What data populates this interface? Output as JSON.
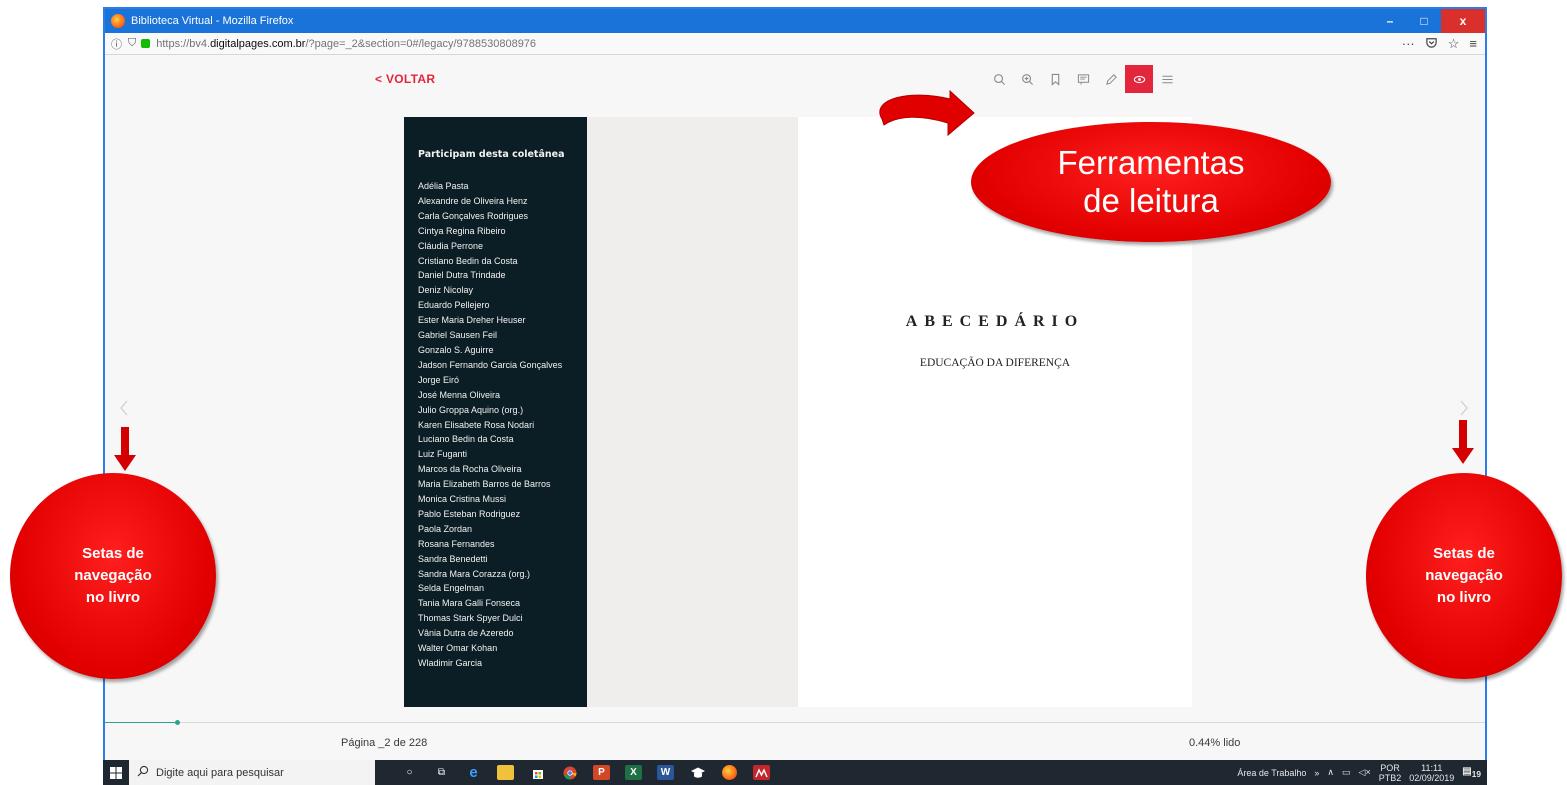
{
  "browser": {
    "window_title": "Biblioteca Virtual - Mozilla Firefox",
    "url_prefix": "https://bv4.",
    "url_domain": "digitalpages.com.br",
    "url_path": "/?page=_2&section=0#/legacy/9788530808976",
    "controls": {
      "minimize": "–",
      "maximize": "□",
      "close": "x"
    }
  },
  "reader": {
    "back_label": "< VOLTAR",
    "tools": [
      {
        "icon": "search-icon"
      },
      {
        "icon": "zoom-in-icon"
      },
      {
        "icon": "bookmark-icon"
      },
      {
        "icon": "notes-icon"
      },
      {
        "icon": "pencil-icon"
      },
      {
        "icon": "eye-icon",
        "active": true
      },
      {
        "icon": "menu-icon"
      }
    ],
    "accent_color": "#e3263b",
    "page_info": "Página _2 de 228",
    "progress_label": "0.44% lido",
    "progress_fraction": 0.0044
  },
  "book": {
    "left_heading": "Participam desta coletânea",
    "contributors": [
      "Adélia Pasta",
      "Alexandre de Oliveira Henz",
      "Carla Gonçalves Rodrigues",
      "Cintya Regina Ribeiro",
      "Cláudia Perrone",
      "Cristiano Bedin da Costa",
      "Daniel Dutra Trindade",
      "Deniz Nicolay",
      "Eduardo Pellejero",
      "Ester Maria Dreher Heuser",
      "Gabriel Sausen Feil",
      "Gonzalo S. Aguirre",
      "Jadson Fernando Garcia Gonçalves",
      "Jorge Eiró",
      "José Menna Oliveira",
      "Julio Groppa Aquino (org.)",
      "Karen Elisabete Rosa Nodari",
      "Luciano Bedin da Costa",
      "Luiz Fuganti",
      "Marcos da Rocha Oliveira",
      "Maria Elizabeth Barros de Barros",
      "Monica Cristina Mussi",
      "Pablo Esteban Rodriguez",
      "Paola Zordan",
      "Rosana Fernandes",
      "Sandra Benedetti",
      "Sandra Mara Corazza (org.)",
      "Selda Engelman",
      "Tania Mara Galli Fonseca",
      "Thomas Stark Spyer Dulci",
      "Vânia Dutra de Azeredo",
      "Walter Omar Kohan",
      "Wladimir Garcia"
    ],
    "title": "ABECEDÁRIO",
    "subtitle": "EDUCAÇÃO DA DIFERENÇA"
  },
  "annotations": {
    "tools_callout": [
      "Ferramentas",
      "de leitura"
    ],
    "nav_callout_left": [
      "Setas de",
      "navegação",
      "no livro"
    ],
    "nav_callout_right": [
      "Setas de",
      "navegação",
      "no livro"
    ],
    "callout_color": "#e20000"
  },
  "taskbar": {
    "search_placeholder": "Digite aqui para pesquisar",
    "desktop_label": "Área de Trabalho",
    "lang_top": "POR",
    "lang_bottom": "PTB2",
    "time": "11:11",
    "date": "02/09/2019",
    "notification_count": "19"
  }
}
